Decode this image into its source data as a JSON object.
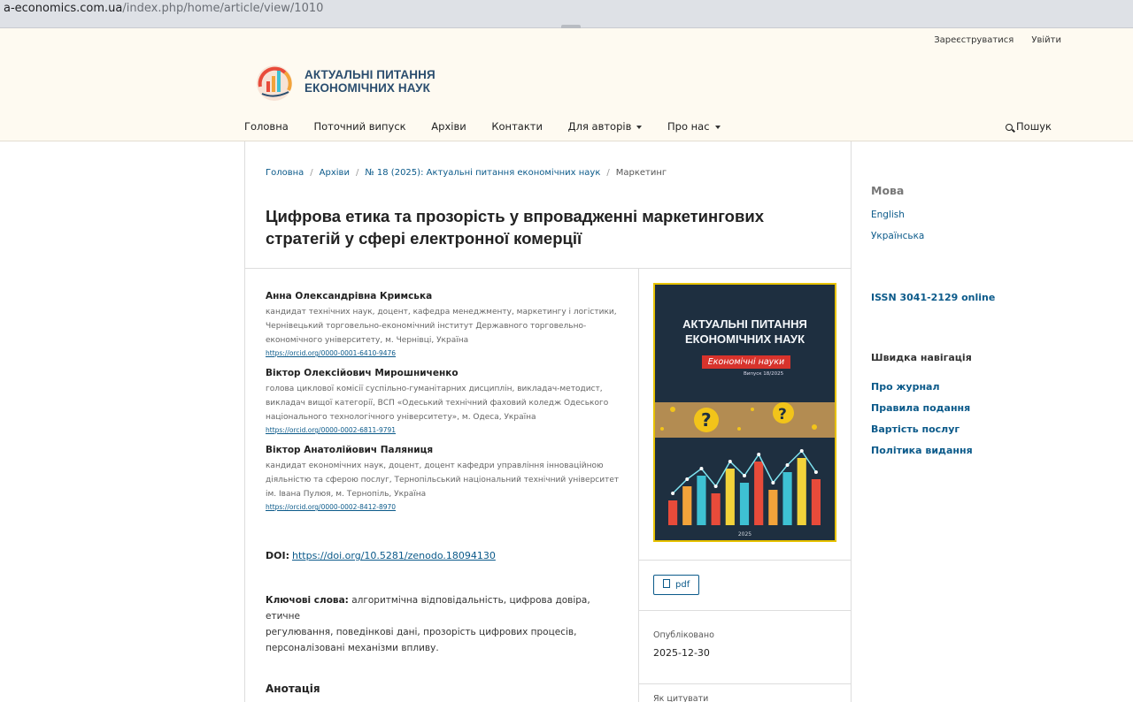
{
  "browser": {
    "url_host": "a-economics.com.ua",
    "url_path": "/index.php/home/article/view/1010"
  },
  "header": {
    "register": "Зареєструватися",
    "login": "Увійти",
    "logo_line1": "АКТУАЛЬНІ ПИТАННЯ",
    "logo_line2": "ЕКОНОМІЧНИХ НАУК",
    "nav": [
      "Головна",
      "Поточний випуск",
      "Архіви",
      "Контакти",
      "Для авторів",
      "Про нас"
    ],
    "search": "Пошук"
  },
  "breadcrumb": {
    "home": "Головна",
    "archives": "Архіви",
    "issue": "№ 18 (2025): Актуальні питання економічних наук",
    "section": "Маркетинг"
  },
  "article": {
    "title": "Цифрова етика та прозорість у впровадженні маркетингових стратегій у сфері електронної комерції",
    "authors": [
      {
        "name": "Анна Олександрівна Кримська",
        "aff_lines": [
          "кандидат технічних наук, доцент, кафедра менеджменту, маркетингу і логістики,",
          "Чернівецький торговельно-економічний інститут Державного торговельно-",
          "економічного університету, м. Чернівці, Україна"
        ],
        "orcid": "https://orcid.org/0000-0001-6410-9476"
      },
      {
        "name": "Віктор Олексійович Мирошниченко",
        "aff_lines": [
          "голова циклової комісії суспільно-гуманітарних дисциплін, викладач-методист,",
          "викладач вищої категорії, ВСП «Одеський технічний фаховий коледж Одеського",
          "національного технологічного університету», м. Одеса, Україна"
        ],
        "orcid": "https://orcid.org/0000-0002-6811-9791"
      },
      {
        "name": "Віктор Анатолійович Паляниця",
        "aff_lines": [
          "кандидат економічних наук, доцент, доцент кафедри управління інноваційною",
          "діяльністю та сферою послуг, Тернопільський національний технічний університет",
          "ім. Івана Пулюя, м. Тернопіль, Україна"
        ],
        "orcid": "https://orcid.org/0000-0002-8412-8970"
      }
    ],
    "doi_label": "DOI:",
    "doi": "https://doi.org/10.5281/zenodo.18094130",
    "keywords_label": "Ключові слова:",
    "keywords_lines": [
      "алгоритмічна відповідальність, цифрова довіра, етичне",
      "регулювання, поведінкові дані, прозорість цифрових процесів,",
      "персоналізовані механізми впливу."
    ],
    "abstract_heading": "Анотація"
  },
  "cover": {
    "title_line1": "АКТУАЛЬНІ ПИТАННЯ",
    "title_line2": "ЕКОНОМІЧНИХ НАУК",
    "band": "Економічні науки",
    "issue": "Випуск 18/2025",
    "year": "2025",
    "bars": [
      0.35,
      0.55,
      0.7,
      0.45,
      0.8,
      0.6,
      0.9,
      0.5,
      0.75,
      0.95,
      0.65
    ],
    "bar_colors": [
      "#e84b3a",
      "#f2a33a",
      "#3ec1d3",
      "#e84b3a",
      "#f2d23a",
      "#3ec1d3",
      "#e84b3a",
      "#f2a33a",
      "#3ec1d3",
      "#f2d23a",
      "#e84b3a"
    ]
  },
  "details": {
    "pdf": "pdf",
    "published_label": "Опубліковано",
    "published_date": "2025-12-30",
    "cite_label": "Як цитувати"
  },
  "sidebar": {
    "lang_heading": "Мова",
    "lang_en": "English",
    "lang_uk": "Українська",
    "issn": "ISSN 3041-2129 online",
    "quick_heading": "Швидка навігація",
    "quick_links": [
      "Про журнал",
      "Правила подання",
      "Вартість послуг",
      "Політика видання"
    ]
  },
  "colors": {
    "link": "#0b5a8a",
    "header_bg": "#fefaf1",
    "cover_border": "#e7c200"
  }
}
